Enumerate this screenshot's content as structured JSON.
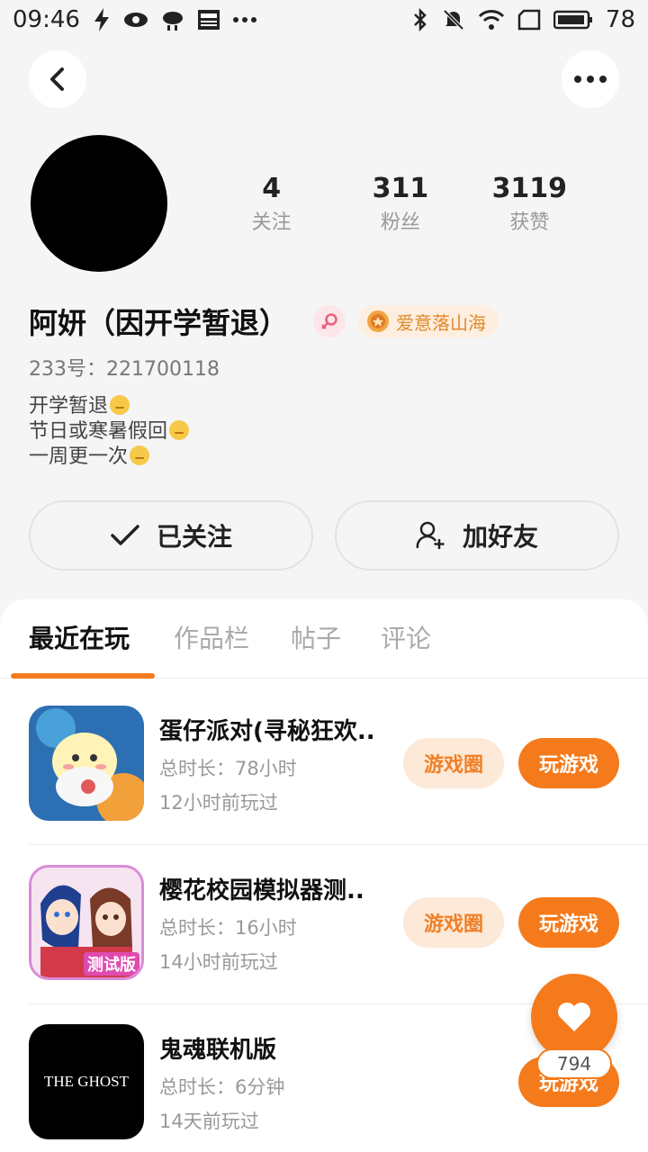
{
  "status_bar": {
    "time": "09:46",
    "battery": "78"
  },
  "profile": {
    "stats": [
      {
        "value": "4",
        "label": "关注"
      },
      {
        "value": "311",
        "label": "粉丝"
      },
      {
        "value": "3119",
        "label": "获赞"
      }
    ],
    "name": "阿妍（因开学暂退）",
    "title_badge": "爱意落山海",
    "user_id": "233号：221700118",
    "bio_lines": [
      "开学暂退",
      "节日或寒暑假回",
      "一周更一次"
    ]
  },
  "actions": {
    "follow_label": "已关注",
    "add_friend_label": "加好友"
  },
  "tabs": [
    {
      "label": "最近在玩"
    },
    {
      "label": "作品栏"
    },
    {
      "label": "帖子"
    },
    {
      "label": "评论"
    }
  ],
  "games": [
    {
      "title": "蛋仔派对(寻秘狂欢..",
      "duration": "总时长：78小时",
      "last_played": "12小时前玩过",
      "circle_label": "游戏圈",
      "play_label": "玩游戏"
    },
    {
      "title": "樱花校园模拟器测..",
      "duration": "总时长：16小时",
      "last_played": "14小时前玩过",
      "circle_label": "游戏圈",
      "play_label": "玩游戏",
      "icon_text": "测试版"
    },
    {
      "title": "鬼魂联机版",
      "duration": "总时长：6分钟",
      "last_played": "14天前玩过",
      "play_label": "玩游戏",
      "icon_text": "THE GHOST"
    }
  ],
  "like": {
    "count": "794"
  },
  "colors": {
    "accent": "#f57a1b",
    "accent_light": "#fde9d8",
    "background": "#f5f5f5"
  }
}
